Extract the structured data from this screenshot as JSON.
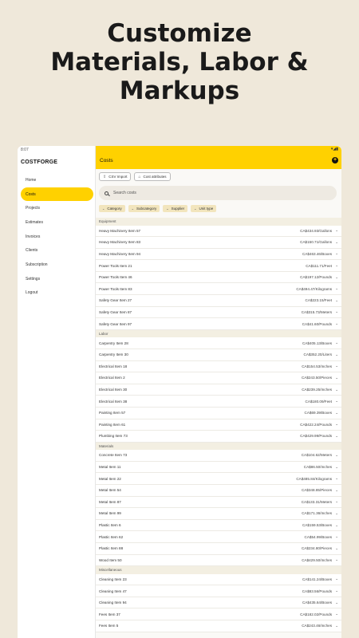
{
  "headline": [
    "Customize",
    "Materials, Labor &",
    "Markups"
  ],
  "status": {
    "time": "8:07",
    "icons": "▾◢▮"
  },
  "brand": "COSTFORGE",
  "nav": [
    "Home",
    "Costs",
    "Projects",
    "Estimates",
    "Invoices",
    "Clients",
    "Subscription",
    "Settings",
    "Logout"
  ],
  "active_nav": 1,
  "appbar": {
    "title": "Costs",
    "add": "+"
  },
  "buttons": {
    "csv": "CSV Import",
    "attributes": "Cost attributes"
  },
  "search": {
    "placeholder": "Search costs"
  },
  "filters": [
    "Category",
    "Subcategory",
    "Supplier",
    "Unit type"
  ],
  "sections": [
    {
      "name": "Equipment",
      "items": [
        {
          "name": "Heavy Machinery Item 57",
          "price": "CA$434.93/Gallons"
        },
        {
          "name": "Heavy Machinery Item 83",
          "price": "CA$150.71/Gallons"
        },
        {
          "name": "Heavy Machinery Item 94",
          "price": "CA$463.46/Boxes"
        },
        {
          "name": "Power Tools Item 21",
          "price": "CA$111.71/Feet"
        },
        {
          "name": "Power Tools Item 46",
          "price": "CA$197.12/Pounds"
        },
        {
          "name": "Power Tools Item 83",
          "price": "CA$494.47/Kilograms"
        },
        {
          "name": "Safety Gear Item 27",
          "price": "CA$223.15/Feet"
        },
        {
          "name": "Safety Gear Item 87",
          "price": "CA$315.73/Meters"
        },
        {
          "name": "Safety Gear Item 97",
          "price": "CA$41.60/Pounds"
        }
      ]
    },
    {
      "name": "Labor",
      "items": [
        {
          "name": "Carpentry Item 28",
          "price": "CA$405.13/Boxes"
        },
        {
          "name": "Carpentry Item 30",
          "price": "CA$352.20/Liters"
        },
        {
          "name": "Electrical Item 18",
          "price": "CA$154.53/Inches"
        },
        {
          "name": "Electrical Item 2",
          "price": "CA$243.50/Pieces"
        },
        {
          "name": "Electrical Item 30",
          "price": "CA$239.25/Inches"
        },
        {
          "name": "Electrical Item 38",
          "price": "CA$180.09/Feet"
        },
        {
          "name": "Painting Item 57",
          "price": "CA$69.39/Boxes"
        },
        {
          "name": "Painting Item 61",
          "price": "CA$422.24/Pounds"
        },
        {
          "name": "Plumbing Item 73",
          "price": "CA$429.99/Pounds"
        }
      ]
    },
    {
      "name": "Materials",
      "items": [
        {
          "name": "Concrete Item 73",
          "price": "CA$104.62/Meters"
        },
        {
          "name": "Metal Item 11",
          "price": "CA$86.50/Inches"
        },
        {
          "name": "Metal Item 22",
          "price": "CA$485.84/Kilograms"
        },
        {
          "name": "Metal Item 54",
          "price": "CA$348.85/Pieces"
        },
        {
          "name": "Metal Item 87",
          "price": "CA$133.31/Meters"
        },
        {
          "name": "Metal Item 99",
          "price": "CA$171.36/Inches"
        },
        {
          "name": "Plastic Item 6",
          "price": "CA$159.53/Boxes"
        },
        {
          "name": "Plastic Item 62",
          "price": "CA$54.99/Boxes"
        },
        {
          "name": "Plastic Item 88",
          "price": "CA$234.80/Pieces"
        },
        {
          "name": "Wood Item 50",
          "price": "CA$429.50/Inches"
        }
      ]
    },
    {
      "name": "Miscellaneous",
      "items": [
        {
          "name": "Cleaning Item 23",
          "price": "CA$141.24/Boxes"
        },
        {
          "name": "Cleaning Item 47",
          "price": "CA$83.56/Pounds"
        },
        {
          "name": "Cleaning Item 94",
          "price": "CA$435.64/Boxes"
        },
        {
          "name": "Fees Item 37",
          "price": "CA$182.02/Pounds"
        },
        {
          "name": "Fees Item 5",
          "price": "CA$243.46/Inches"
        }
      ]
    }
  ]
}
